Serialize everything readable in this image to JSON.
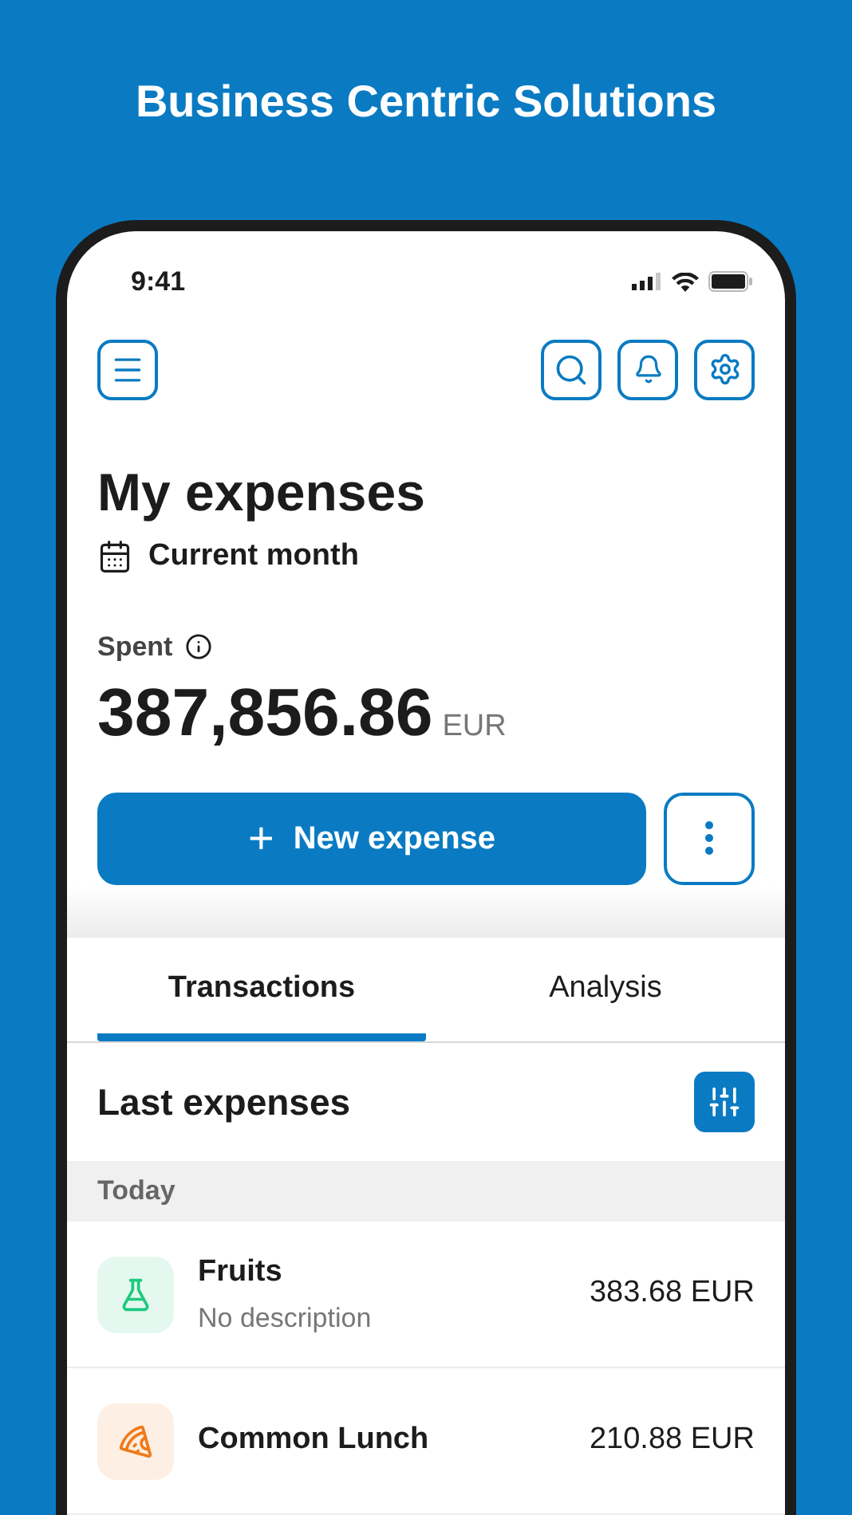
{
  "headline": "Business Centric Solutions",
  "status_bar": {
    "time": "9:41"
  },
  "title": "My expenses",
  "period": "Current month",
  "spent": {
    "label": "Spent",
    "amount": "387,856.86",
    "currency": "EUR"
  },
  "new_expense_button": {
    "icon": "+",
    "label": "New expense"
  },
  "tabs": [
    {
      "label": "Transactions",
      "selected": true
    },
    {
      "label": "Analysis",
      "selected": false
    }
  ],
  "section_title": "Last expenses",
  "group_header": "Today",
  "expenses": [
    {
      "kind": "flask",
      "color": "#1ec97e",
      "name": "Fruits",
      "description": "No description",
      "amount": "383.68 EUR"
    },
    {
      "kind": "pizza",
      "color": "#f07a1a",
      "name": "Common Lunch",
      "amount": "210.88 EUR"
    }
  ]
}
